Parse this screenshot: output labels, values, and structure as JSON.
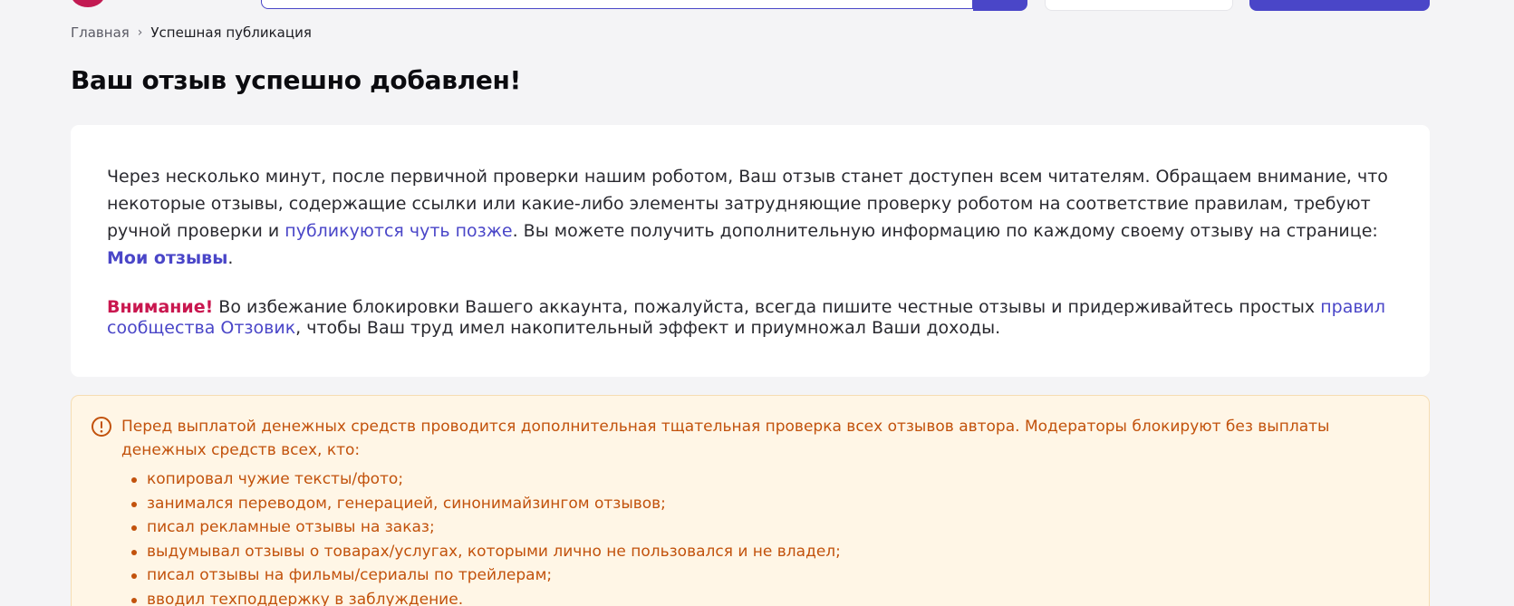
{
  "breadcrumb": {
    "home": "Главная",
    "separator": "›",
    "current": "Успешная публикация"
  },
  "page_title": "Ваш отзыв успешно добавлен!",
  "info": {
    "p1_text1": "Через несколько минут, после первичной проверки нашим роботом, Ваш отзыв станет доступен всем читателям. Обращаем внимание, что некоторые отзывы, содержащие ссылки или какие-либо элементы затрудняющие проверку роботом на соответствие правилам, требуют ручной проверки и ",
    "p1_link": "публикуются чуть позже",
    "p1_text2": ". Вы можете получить дополнительную информацию по каждому своему отзыву на странице: ",
    "my_reviews_link": "Мои отзывы",
    "p1_end": ".",
    "attention_label": "Внимание!",
    "p2_text1": " Во избежание блокировки Вашего аккаунта, пожалуйста, всегда пишите честные отзывы и придерживайтесь простых ",
    "p2_link": "правил сообщества Отзовик",
    "p2_text2": ", чтобы Ваш труд имел накопительный эффект и приумножал Ваши доходы."
  },
  "notice": {
    "icon": "alert-circle-icon",
    "text": "Перед выплатой денежных средств проводится дополнительная тщательная проверка всех отзывов автора. Модераторы блокируют без выплаты денежных средств всех, кто:",
    "items": [
      "копировал чужие тексты/фото;",
      "занимался переводом, генерацией, синонимайзингом отзывов;",
      "писал рекламные отзывы на заказ;",
      "выдумывал отзывы о товарах/услугах, которыми лично не пользовался и не владел;",
      "писал отзывы на фильмы/сериалы по трейлерам;",
      "вводил техподдержку в заблуждение."
    ]
  },
  "colors": {
    "accent": "#4a46c8",
    "brand": "#c21a52",
    "attention": "#c9174f",
    "notice_text": "#c2520c",
    "notice_bg": "#fff6e6"
  }
}
